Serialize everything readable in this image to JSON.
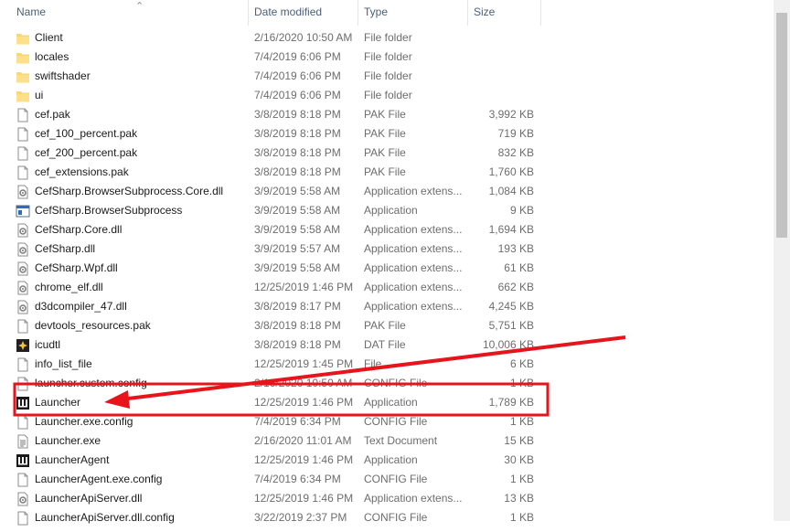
{
  "columns": {
    "name": "Name",
    "date": "Date modified",
    "type": "Type",
    "size": "Size"
  },
  "sort_icon": "sort-ascending-icon",
  "files": [
    {
      "name": "Client",
      "date": "2/16/2020 10:50 AM",
      "type": "File folder",
      "size": "",
      "icon": "folder-icon"
    },
    {
      "name": "locales",
      "date": "7/4/2019 6:06 PM",
      "type": "File folder",
      "size": "",
      "icon": "folder-icon"
    },
    {
      "name": "swiftshader",
      "date": "7/4/2019 6:06 PM",
      "type": "File folder",
      "size": "",
      "icon": "folder-icon"
    },
    {
      "name": "ui",
      "date": "7/4/2019 6:06 PM",
      "type": "File folder",
      "size": "",
      "icon": "folder-icon"
    },
    {
      "name": "cef.pak",
      "date": "3/8/2019 8:18 PM",
      "type": "PAK File",
      "size": "3,992 KB",
      "icon": "file-icon"
    },
    {
      "name": "cef_100_percent.pak",
      "date": "3/8/2019 8:18 PM",
      "type": "PAK File",
      "size": "719 KB",
      "icon": "file-icon"
    },
    {
      "name": "cef_200_percent.pak",
      "date": "3/8/2019 8:18 PM",
      "type": "PAK File",
      "size": "832 KB",
      "icon": "file-icon"
    },
    {
      "name": "cef_extensions.pak",
      "date": "3/8/2019 8:18 PM",
      "type": "PAK File",
      "size": "1,760 KB",
      "icon": "file-icon"
    },
    {
      "name": "CefSharp.BrowserSubprocess.Core.dll",
      "date": "3/9/2019 5:58 AM",
      "type": "Application extens...",
      "size": "1,084 KB",
      "icon": "dll-icon"
    },
    {
      "name": "CefSharp.BrowserSubprocess",
      "date": "3/9/2019 5:58 AM",
      "type": "Application",
      "size": "9 KB",
      "icon": "app-window-icon"
    },
    {
      "name": "CefSharp.Core.dll",
      "date": "3/9/2019 5:58 AM",
      "type": "Application extens...",
      "size": "1,694 KB",
      "icon": "dll-icon"
    },
    {
      "name": "CefSharp.dll",
      "date": "3/9/2019 5:57 AM",
      "type": "Application extens...",
      "size": "193 KB",
      "icon": "dll-icon"
    },
    {
      "name": "CefSharp.Wpf.dll",
      "date": "3/9/2019 5:58 AM",
      "type": "Application extens...",
      "size": "61 KB",
      "icon": "dll-icon"
    },
    {
      "name": "chrome_elf.dll",
      "date": "12/25/2019 1:46 PM",
      "type": "Application extens...",
      "size": "662 KB",
      "icon": "dll-icon"
    },
    {
      "name": "d3dcompiler_47.dll",
      "date": "3/8/2019 8:17 PM",
      "type": "Application extens...",
      "size": "4,245 KB",
      "icon": "dll-icon"
    },
    {
      "name": "devtools_resources.pak",
      "date": "3/8/2019 8:18 PM",
      "type": "PAK File",
      "size": "5,751 KB",
      "icon": "file-icon"
    },
    {
      "name": "icudtl",
      "date": "3/8/2019 8:18 PM",
      "type": "DAT File",
      "size": "10,006 KB",
      "icon": "dat-icon"
    },
    {
      "name": "info_list_file",
      "date": "12/25/2019 1:45 PM",
      "type": "File",
      "size": "6 KB",
      "icon": "file-icon"
    },
    {
      "name": "launcher.custom.config",
      "date": "2/16/2020 10:50 AM",
      "type": "CONFIG File",
      "size": "1 KB",
      "icon": "file-icon"
    },
    {
      "name": "Launcher",
      "date": "12/25/2019 1:46 PM",
      "type": "Application",
      "size": "1,789 KB",
      "icon": "launcher-app-icon"
    },
    {
      "name": "Launcher.exe.config",
      "date": "7/4/2019 6:34 PM",
      "type": "CONFIG File",
      "size": "1 KB",
      "icon": "file-icon"
    },
    {
      "name": "Launcher.exe",
      "date": "2/16/2020 11:01 AM",
      "type": "Text Document",
      "size": "15 KB",
      "icon": "text-file-icon"
    },
    {
      "name": "LauncherAgent",
      "date": "12/25/2019 1:46 PM",
      "type": "Application",
      "size": "30 KB",
      "icon": "launcher-app-icon"
    },
    {
      "name": "LauncherAgent.exe.config",
      "date": "7/4/2019 6:34 PM",
      "type": "CONFIG File",
      "size": "1 KB",
      "icon": "file-icon"
    },
    {
      "name": "LauncherApiServer.dll",
      "date": "12/25/2019 1:46 PM",
      "type": "Application extens...",
      "size": "13 KB",
      "icon": "dll-icon"
    },
    {
      "name": "LauncherApiServer.dll.config",
      "date": "3/22/2019 2:37 PM",
      "type": "CONFIG File",
      "size": "1 KB",
      "icon": "file-icon"
    }
  ],
  "colors": {
    "annotation": "#e8141b",
    "header_text": "#4c607a",
    "detail_text": "#6d6d6d"
  }
}
